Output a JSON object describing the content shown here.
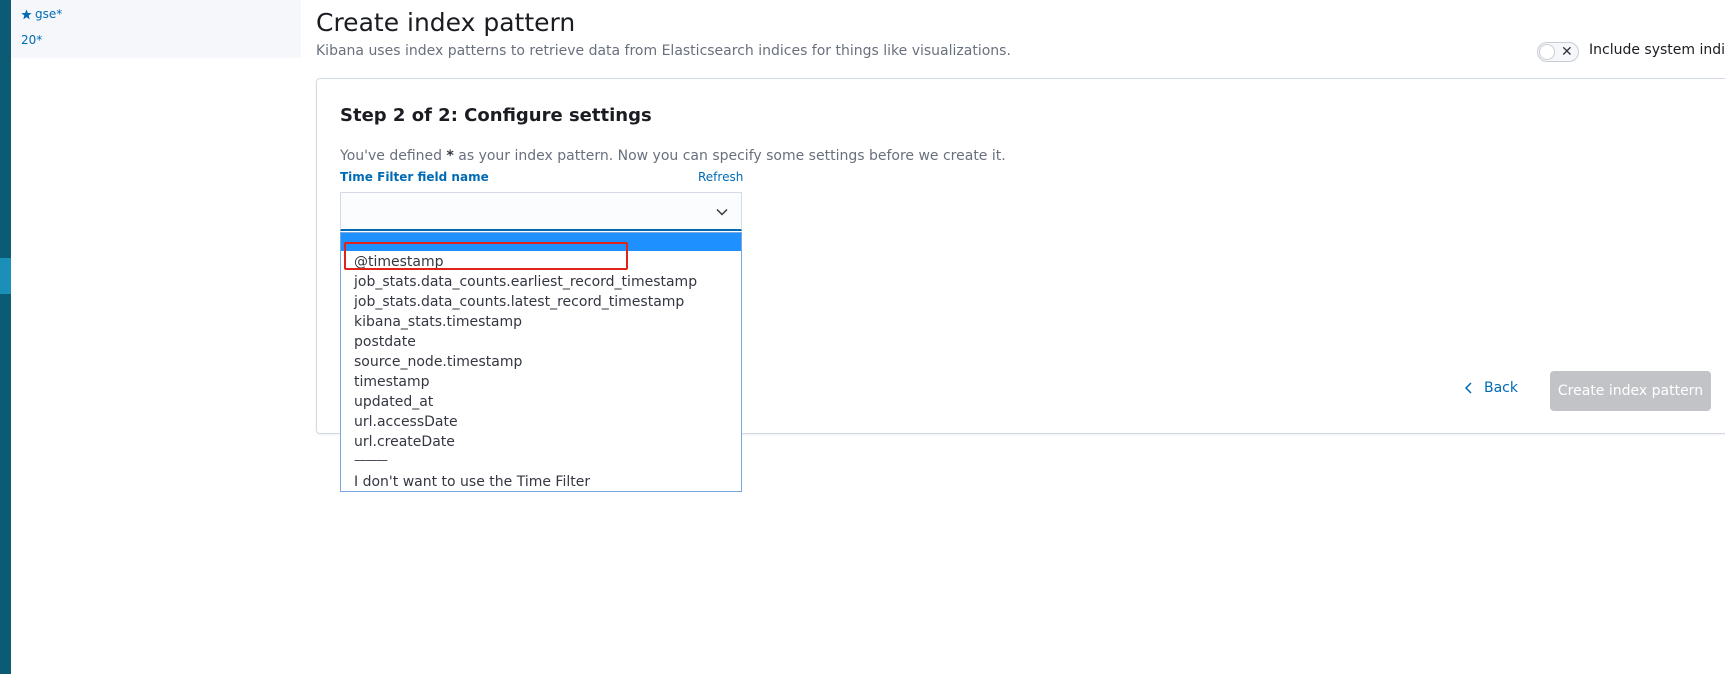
{
  "patterns": [
    {
      "label": "gse*",
      "starred": true
    },
    {
      "label": "20*",
      "starred": false
    }
  ],
  "header": {
    "title": "Create index pattern",
    "subtitle": "Kibana uses index patterns to retrieve data from Elasticsearch indices for things like visualizations.",
    "include_system_label": "Include system indices"
  },
  "step": {
    "title": "Step 2 of 2: Configure settings",
    "desc_before": "You've defined ",
    "pattern": "*",
    "desc_after": " as your index pattern. Now you can specify some settings before we create it."
  },
  "time_filter": {
    "label": "Time Filter field name",
    "refresh": "Refresh",
    "selected_value": "",
    "options": [
      "@timestamp",
      "job_stats.data_counts.earliest_record_timestamp",
      "job_stats.data_counts.latest_record_timestamp",
      "kibana_stats.timestamp",
      "postdate",
      "source_node.timestamp",
      "timestamp",
      "updated_at",
      "url.accessDate",
      "url.createDate",
      "———",
      "I don't want to use the Time Filter"
    ]
  },
  "actions": {
    "back": "Back",
    "create": "Create index pattern"
  },
  "colors": {
    "accent": "#006bb4",
    "nav": "#0b5b75",
    "highlight": "#1e90ff",
    "annotation": "#e0241a",
    "disabled_button": "#c2c3c6"
  }
}
